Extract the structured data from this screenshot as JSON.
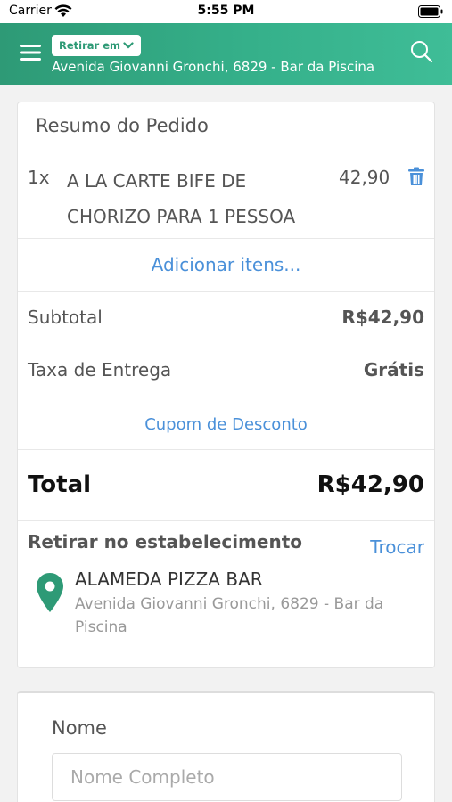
{
  "status_bar": {
    "carrier": "Carrier",
    "time": "5:55 PM"
  },
  "header": {
    "pickup_button": "Retirar em",
    "address": "Avenida Giovanni Gronchi, 6829 - Bar da Piscina"
  },
  "order": {
    "title": "Resumo do Pedido",
    "items": [
      {
        "qty": "1x",
        "name": "A LA CARTE BIFE DE CHORIZO PARA 1 PESSOA",
        "price": "42,90"
      }
    ],
    "add_items": "Adicionar itens...",
    "subtotal_label": "Subtotal",
    "subtotal_value": "R$42,90",
    "delivery_label": "Taxa de Entrega",
    "delivery_value": "Grátis",
    "coupon": "Cupom de Desconto",
    "total_label": "Total",
    "total_value": "R$42,90"
  },
  "pickup": {
    "title": "Retirar no estabelecimento",
    "change": "Trocar",
    "store_name": "ALAMEDA PIZZA BAR",
    "store_address": "Avenida Giovanni Gronchi, 6829 - Bar da Piscina"
  },
  "form": {
    "name_label": "Nome",
    "name_placeholder": "Nome Completo",
    "name_value": ""
  },
  "colors": {
    "accent": "#35b08a",
    "link": "#4a90d9",
    "pin": "#2e9a76"
  },
  "icons": [
    "wifi-icon",
    "battery-icon",
    "menu-icon",
    "chevron-down-icon",
    "search-icon",
    "trash-icon",
    "map-pin-icon"
  ]
}
